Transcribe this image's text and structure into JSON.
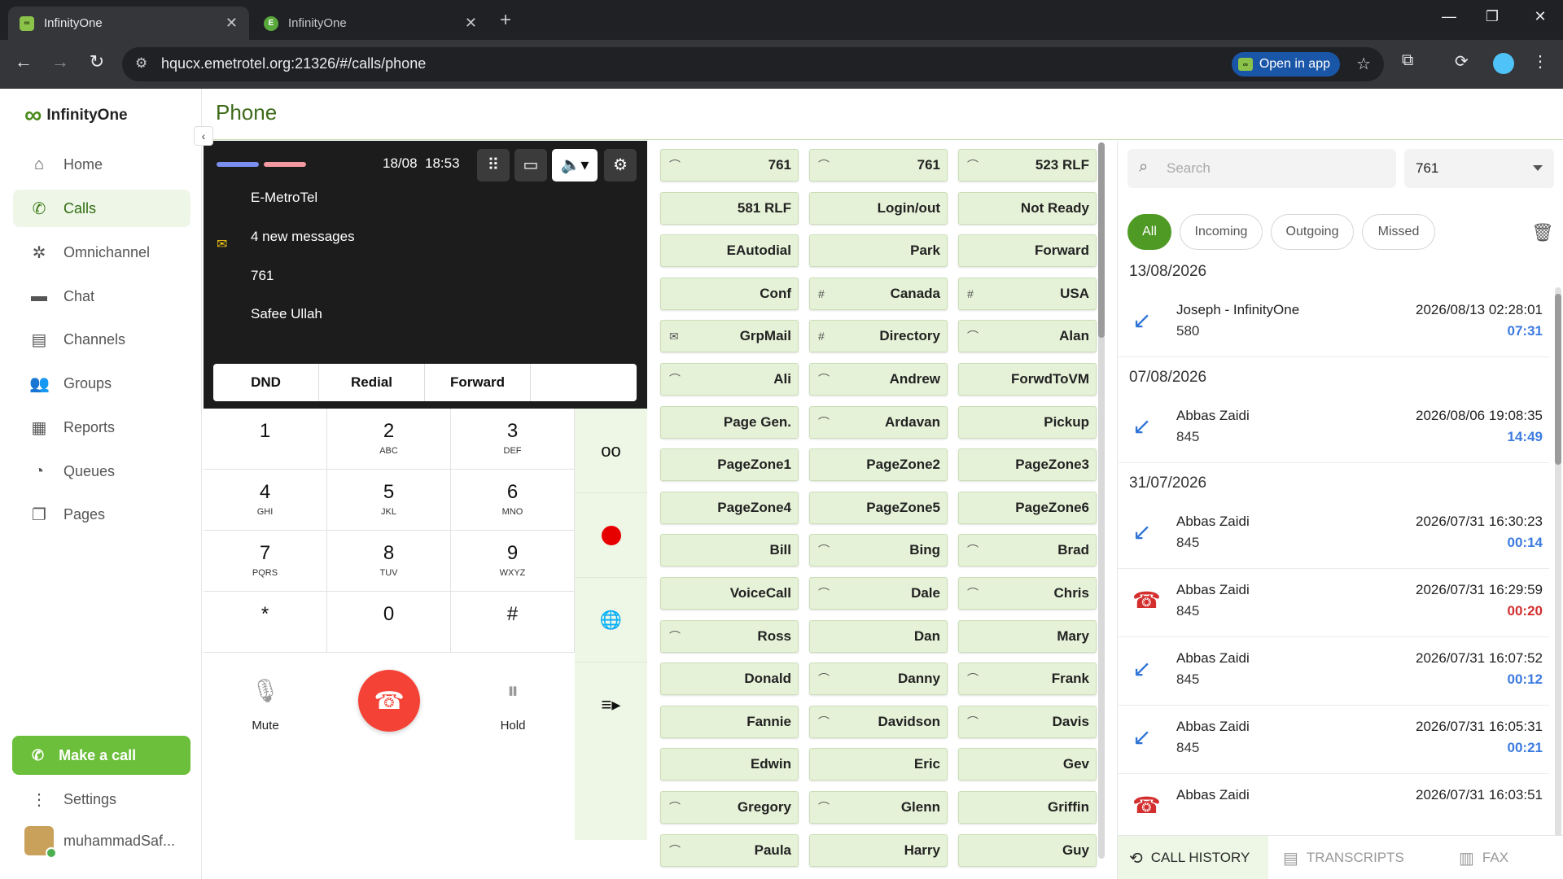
{
  "browser": {
    "tabs": [
      {
        "title": "InfinityOne",
        "active": true
      },
      {
        "title": "InfinityOne",
        "active": false
      }
    ],
    "url": "hqucx.emetrotel.org:21326/#/calls/phone",
    "open_in_app": "Open in app"
  },
  "app": {
    "brand": "InfinityOne",
    "page_title": "Phone",
    "nav": [
      {
        "label": "Home",
        "icon": "home-icon",
        "active": false
      },
      {
        "label": "Calls",
        "icon": "phone-icon",
        "active": true
      },
      {
        "label": "Omnichannel",
        "icon": "omnichannel-icon",
        "active": false
      },
      {
        "label": "Chat",
        "icon": "chat-icon",
        "active": false
      },
      {
        "label": "Channels",
        "icon": "channels-icon",
        "active": false
      },
      {
        "label": "Groups",
        "icon": "groups-icon",
        "active": false
      },
      {
        "label": "Reports",
        "icon": "reports-icon",
        "active": false
      },
      {
        "label": "Queues",
        "icon": "queues-icon",
        "active": false
      },
      {
        "label": "Pages",
        "icon": "pages-icon",
        "active": false
      }
    ],
    "make_call": "Make a call",
    "settings": "Settings",
    "user_name": "muhammadSaf..."
  },
  "phone": {
    "date": "18/08",
    "time": "18:53",
    "company": "E-MetroTel",
    "messages": "4 new messages",
    "extension": "761",
    "user": "Safee Ullah",
    "functions": [
      "DND",
      "Redial",
      "Forward",
      ""
    ],
    "keys": [
      {
        "d": "1",
        "l": ""
      },
      {
        "d": "2",
        "l": "ABC"
      },
      {
        "d": "3",
        "l": "DEF"
      },
      {
        "d": "4",
        "l": "GHI"
      },
      {
        "d": "5",
        "l": "JKL"
      },
      {
        "d": "6",
        "l": "MNO"
      },
      {
        "d": "7",
        "l": "PQRS"
      },
      {
        "d": "8",
        "l": "TUV"
      },
      {
        "d": "9",
        "l": "WXYZ"
      },
      {
        "d": "*",
        "l": ""
      },
      {
        "d": "0",
        "l": ""
      },
      {
        "d": "#",
        "l": ""
      }
    ],
    "mute": "Mute",
    "hold": "Hold",
    "colors": {
      "line1": "#7b8ff0",
      "line2": "#f29aa0",
      "record": "#e60000",
      "hangup": "#f44336"
    }
  },
  "blf": [
    {
      "label": "761",
      "icon": "handset"
    },
    {
      "label": "761",
      "icon": "handset"
    },
    {
      "label": "523 RLF",
      "icon": "handset"
    },
    {
      "label": "581 RLF",
      "icon": ""
    },
    {
      "label": "Login/out",
      "icon": ""
    },
    {
      "label": "Not Ready",
      "icon": ""
    },
    {
      "label": "EAutodial",
      "icon": ""
    },
    {
      "label": "Park",
      "icon": ""
    },
    {
      "label": "Forward",
      "icon": ""
    },
    {
      "label": "Conf",
      "icon": ""
    },
    {
      "label": "Canada",
      "icon": "hash"
    },
    {
      "label": "USA",
      "icon": "hash"
    },
    {
      "label": "GrpMail",
      "icon": "mail"
    },
    {
      "label": "Directory",
      "icon": "hash"
    },
    {
      "label": "Alan",
      "icon": "handset"
    },
    {
      "label": "Ali",
      "icon": "handset"
    },
    {
      "label": "Andrew",
      "icon": "handset"
    },
    {
      "label": "ForwdToVM",
      "icon": ""
    },
    {
      "label": "Page Gen.",
      "icon": ""
    },
    {
      "label": "Ardavan",
      "icon": "handset"
    },
    {
      "label": "Pickup",
      "icon": ""
    },
    {
      "label": "PageZone1",
      "icon": ""
    },
    {
      "label": "PageZone2",
      "icon": ""
    },
    {
      "label": "PageZone3",
      "icon": ""
    },
    {
      "label": "PageZone4",
      "icon": ""
    },
    {
      "label": "PageZone5",
      "icon": ""
    },
    {
      "label": "PageZone6",
      "icon": ""
    },
    {
      "label": "Bill",
      "icon": ""
    },
    {
      "label": "Bing",
      "icon": "handset"
    },
    {
      "label": "Brad",
      "icon": "handset"
    },
    {
      "label": "VoiceCall",
      "icon": ""
    },
    {
      "label": "Dale",
      "icon": "handset"
    },
    {
      "label": "Chris",
      "icon": "handset"
    },
    {
      "label": "Ross",
      "icon": "handset"
    },
    {
      "label": "Dan",
      "icon": ""
    },
    {
      "label": "Mary",
      "icon": ""
    },
    {
      "label": "Donald",
      "icon": ""
    },
    {
      "label": "Danny",
      "icon": "handset"
    },
    {
      "label": "Frank",
      "icon": "handset"
    },
    {
      "label": "Fannie",
      "icon": ""
    },
    {
      "label": "Davidson",
      "icon": "handset"
    },
    {
      "label": "Davis",
      "icon": "handset"
    },
    {
      "label": "Edwin",
      "icon": ""
    },
    {
      "label": "Eric",
      "icon": ""
    },
    {
      "label": "Gev",
      "icon": ""
    },
    {
      "label": "Gregory",
      "icon": "handset"
    },
    {
      "label": "Glenn",
      "icon": "handset"
    },
    {
      "label": "Griffin",
      "icon": ""
    },
    {
      "label": "Paula",
      "icon": "handset"
    },
    {
      "label": "Harry",
      "icon": ""
    },
    {
      "label": "Guy",
      "icon": ""
    }
  ],
  "history": {
    "search_placeholder": "Search",
    "extension": "761",
    "filters": [
      {
        "label": "All",
        "active": true
      },
      {
        "label": "Incoming",
        "active": false
      },
      {
        "label": "Outgoing",
        "active": false
      },
      {
        "label": "Missed",
        "active": false
      }
    ],
    "groups": [
      {
        "date": "13/08/2026",
        "entries": [
          {
            "name": "Joseph - InfinityOne",
            "number": "580",
            "timestamp": "2026/08/13 02:28:01",
            "duration": "07:31",
            "type": "incoming"
          }
        ]
      },
      {
        "date": "07/08/2026",
        "entries": [
          {
            "name": "Abbas Zaidi",
            "number": "845",
            "timestamp": "2026/08/06 19:08:35",
            "duration": "14:49",
            "type": "incoming"
          }
        ]
      },
      {
        "date": "31/07/2026",
        "entries": [
          {
            "name": "Abbas Zaidi",
            "number": "845",
            "timestamp": "2026/07/31 16:30:23",
            "duration": "00:14",
            "type": "incoming"
          },
          {
            "name": "Abbas Zaidi",
            "number": "845",
            "timestamp": "2026/07/31 16:29:59",
            "duration": "00:20",
            "type": "missed"
          },
          {
            "name": "Abbas Zaidi",
            "number": "845",
            "timestamp": "2026/07/31 16:07:52",
            "duration": "00:12",
            "type": "incoming"
          },
          {
            "name": "Abbas Zaidi",
            "number": "845",
            "timestamp": "2026/07/31 16:05:31",
            "duration": "00:21",
            "type": "incoming"
          },
          {
            "name": "Abbas Zaidi",
            "number": "",
            "timestamp": "2026/07/31 16:03:51",
            "duration": "",
            "type": "missed"
          }
        ]
      }
    ],
    "tabs": [
      {
        "label": "CALL HISTORY",
        "active": true
      },
      {
        "label": "TRANSCRIPTS",
        "active": false
      },
      {
        "label": "FAX",
        "active": false
      }
    ]
  }
}
